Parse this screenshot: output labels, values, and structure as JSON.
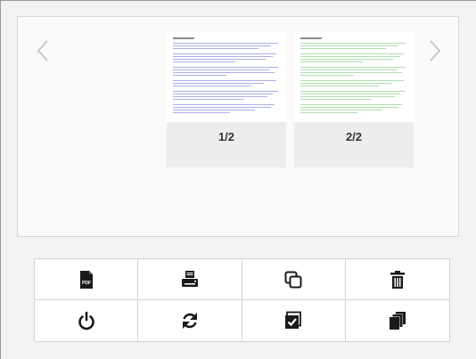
{
  "viewer": {
    "prev_icon": "chevron-left-icon",
    "next_icon": "chevron-right-icon",
    "pages": [
      {
        "label": "1/2",
        "text_color": "#6b6bd8"
      },
      {
        "label": "2/2",
        "text_color": "#6cc46c"
      }
    ]
  },
  "toolbar": {
    "buttons": [
      {
        "name": "export-pdf-button",
        "icon": "pdf-file-icon"
      },
      {
        "name": "print-button",
        "icon": "printer-icon"
      },
      {
        "name": "duplicate-button",
        "icon": "copy-icon"
      },
      {
        "name": "delete-button",
        "icon": "trash-icon"
      },
      {
        "name": "power-button",
        "icon": "power-icon"
      },
      {
        "name": "refresh-button",
        "icon": "refresh-icon"
      },
      {
        "name": "select-button",
        "icon": "checked-box-icon"
      },
      {
        "name": "stack-button",
        "icon": "stacked-pages-icon"
      }
    ],
    "pdf_icon_text": "PDF"
  },
  "colors": {
    "icon": "#1a1a1a",
    "page_card_bg": "#ededed"
  }
}
